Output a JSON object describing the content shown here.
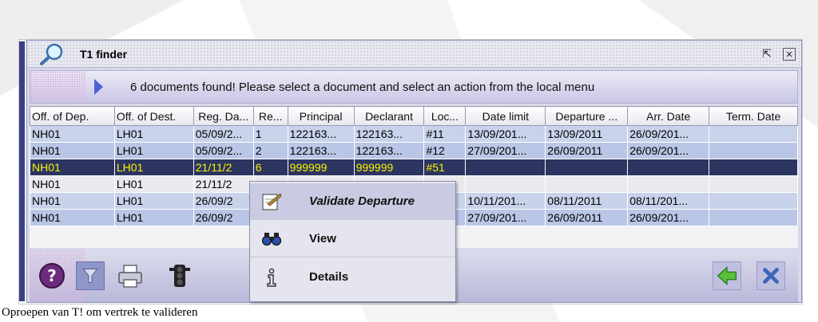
{
  "window": {
    "title": "T1 finder"
  },
  "banner": {
    "message": "6 documents found! Please select a document and select an action from the local menu"
  },
  "table": {
    "columns": [
      "Off. of Dep.",
      "Off. of Dest.",
      "Reg. Da...",
      "Re...",
      "Principal",
      "Declarant",
      "Loc...",
      "Date limit",
      "Departure ...",
      "Arr. Date",
      "Term. Date"
    ],
    "rows": [
      [
        "NH01",
        "LH01",
        "05/09/2...",
        "1",
        "122163...",
        "122163...",
        "#11",
        "13/09/201...",
        "13/09/2011",
        "26/09/201...",
        ""
      ],
      [
        "NH01",
        "LH01",
        "05/09/2...",
        "2",
        "122163...",
        "122163...",
        "#12",
        "27/09/201...",
        "26/09/2011",
        "26/09/201...",
        ""
      ],
      [
        "NH01",
        "LH01",
        "21/11/2",
        "6",
        "999999",
        "999999",
        "#51",
        "",
        "",
        "",
        ""
      ],
      [
        "NH01",
        "LH01",
        "21/11/2",
        "",
        "",
        "",
        "",
        "",
        "",
        "",
        ""
      ],
      [
        "NH01",
        "LH01",
        "26/09/2",
        "",
        "",
        "",
        "",
        "10/11/201...",
        "08/11/2011",
        "08/11/201...",
        ""
      ],
      [
        "NH01",
        "LH01",
        "26/09/2",
        "",
        "",
        "",
        "",
        "27/09/201...",
        "26/09/2011",
        "26/09/201...",
        ""
      ]
    ]
  },
  "context_menu": {
    "items": [
      {
        "label": "Validate Departure",
        "icon": "validate-icon"
      },
      {
        "label": "View",
        "icon": "binoculars-icon"
      },
      {
        "label": "Details",
        "icon": "info-icon"
      }
    ]
  },
  "caption": "Oproepen van T! om vertrek te valideren"
}
